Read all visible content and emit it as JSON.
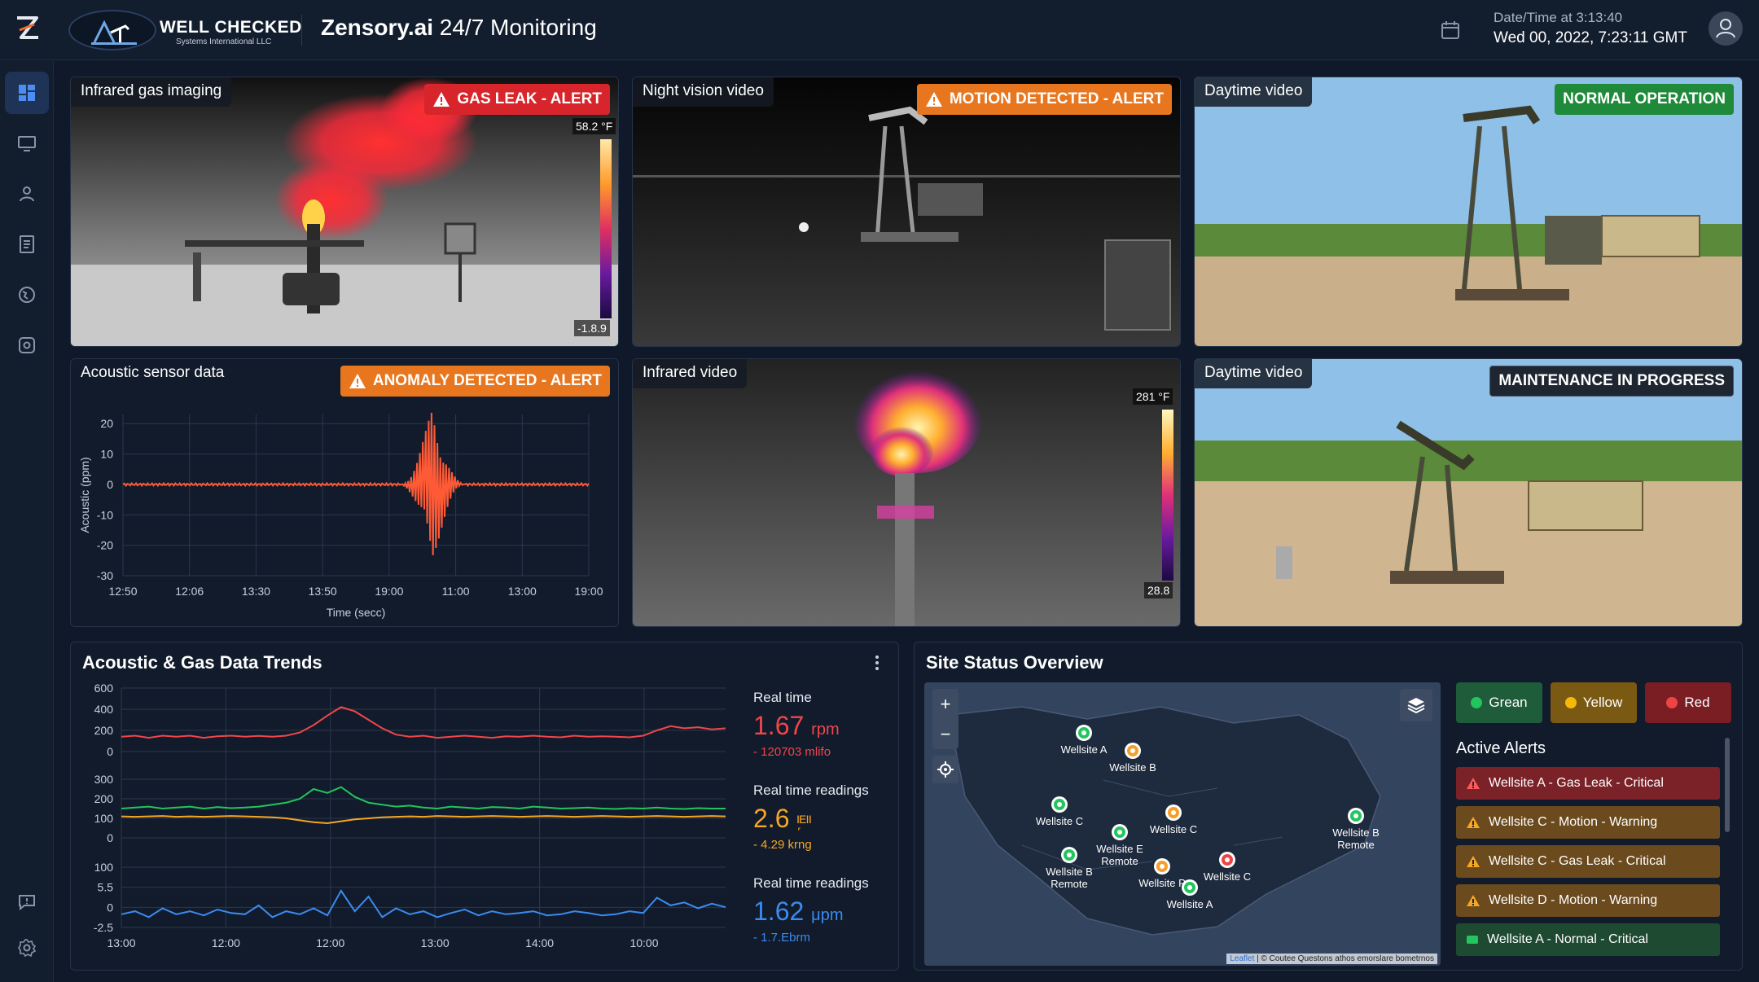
{
  "header": {
    "brand_name": "WELL CHECKED",
    "brand_sub": "Systems International LLC",
    "app_title_bold": "Zensory.ai",
    "app_title_rest": " 24/7 Monitoring",
    "datetime_label": "Date/Time at 3:13:40",
    "datetime_value": "Wed 00, 2022, 7:23:11 GMT"
  },
  "sidebar": {
    "items": [
      {
        "icon": "dashboard-icon",
        "active": true
      },
      {
        "icon": "monitor-icon"
      },
      {
        "icon": "user-icon"
      },
      {
        "icon": "document-icon"
      },
      {
        "icon": "globe-icon"
      },
      {
        "icon": "gear-badge-icon"
      }
    ],
    "bottom": [
      {
        "icon": "chat-icon"
      },
      {
        "icon": "settings-icon"
      }
    ]
  },
  "cameras": [
    {
      "label": "Infrared gas imaging",
      "badge": "GAS LEAK - ALERT",
      "badge_color": "#d8252b",
      "scale_max": "58.2 °F",
      "scale_min": "-1.8.9"
    },
    {
      "label": "Night vision video",
      "badge": "MOTION DETECTED - ALERT",
      "badge_color": "#e8761e"
    },
    {
      "label": "Daytime video",
      "badge": "NORMAL OPERATION",
      "badge_color": "#1e8a3a"
    },
    {
      "label": "Infrared video",
      "scale_max": "281 °F",
      "scale_min": "28.8"
    },
    {
      "label": "Daytime video",
      "badge": "MAINTENANCE IN PROGRESS"
    }
  ],
  "acoustic": {
    "label": "Acoustic sensor data",
    "badge": "ANOMALY DETECTED - ALERT",
    "badge_color": "#e8761e"
  },
  "trends": {
    "title": "Acoustic & Gas Data Trends",
    "readings": [
      {
        "label": "Real time",
        "value": "1.67",
        "unit": "rpm",
        "sub": "- 120703 mlifo",
        "color": "#f0464a"
      },
      {
        "label": "Real time readings",
        "value": "2.6",
        "unit": "ᴵ᷊ᴱᴵᴵ",
        "sub": "- 4.29 krng",
        "color": "#f5a623"
      },
      {
        "label": "Real time readings",
        "value": "1.62",
        "unit": "μpm",
        "sub": "- 1.7.Ebrm",
        "color": "#3b8bf0"
      }
    ]
  },
  "chart_data": [
    {
      "type": "line",
      "title": "",
      "xlabel": "Time (secc)",
      "ylabel": "Acoustic (ppm)",
      "categories": [
        "12:50",
        "12:06",
        "13:30",
        "13:50",
        "19:00",
        "11:00",
        "13:00",
        "19:00"
      ],
      "y_ticks": [
        20,
        10,
        0,
        -10,
        -20,
        -30
      ],
      "ylim": [
        -30,
        23
      ],
      "series": [
        {
          "color": "#ff5a36",
          "baseline": 0,
          "spike_at_category_index": 4.65,
          "spike_range": [
            -30,
            26
          ]
        }
      ],
      "grid": true
    },
    {
      "type": "line",
      "title": "Acoustic & Gas Data Trends",
      "x_ticks": [
        "13:00",
        "12:00",
        "12:00",
        "13:00",
        "14:00",
        "10:00"
      ],
      "panels": [
        {
          "y_ticks": [
            600,
            400,
            200,
            0
          ],
          "ylim": [
            0,
            600
          ],
          "series": [
            {
              "color": "#f0464a",
              "values": [
                140,
                150,
                130,
                150,
                140,
                150,
                130,
                145,
                150,
                140,
                148,
                140,
                150,
                180,
                250,
                340,
                420,
                380,
                300,
                220,
                160,
                140,
                150,
                130,
                140,
                150,
                140,
                130,
                145,
                140,
                150,
                140,
                135,
                150,
                140,
                145,
                140,
                135,
                150,
                200,
                240,
                220,
                230,
                210,
                220
              ]
            }
          ]
        },
        {
          "y_ticks": [
            300,
            200,
            100,
            0
          ],
          "ylim": [
            0,
            300
          ],
          "series": [
            {
              "color": "#22c55e",
              "values": [
                150,
                155,
                160,
                150,
                155,
                160,
                150,
                158,
                152,
                155,
                160,
                170,
                180,
                200,
                250,
                230,
                260,
                210,
                180,
                170,
                160,
                165,
                155,
                150,
                160,
                155,
                150,
                158,
                155,
                150,
                160,
                155,
                150,
                152,
                155,
                150,
                148,
                152,
                150,
                155,
                150,
                148,
                152,
                150,
                150
              ]
            },
            {
              "color": "#f5a623",
              "values": [
                110,
                108,
                110,
                112,
                108,
                110,
                108,
                110,
                112,
                110,
                108,
                105,
                100,
                90,
                80,
                75,
                85,
                95,
                100,
                105,
                108,
                110,
                108,
                112,
                110,
                108,
                110,
                112,
                110,
                108,
                110,
                112,
                110,
                108,
                110,
                112,
                110,
                108,
                110,
                112,
                110,
                108,
                110,
                112,
                110
              ]
            }
          ]
        },
        {
          "y_ticks": [
            "100",
            "5.5",
            "0",
            "-2.5"
          ],
          "ylim": [
            -2.5,
            100
          ],
          "series": [
            {
              "color": "#3b8bf0",
              "values": [
                20,
                25,
                15,
                30,
                20,
                25,
                18,
                28,
                22,
                20,
                35,
                15,
                25,
                20,
                30,
                18,
                60,
                25,
                50,
                15,
                30,
                20,
                25,
                15,
                22,
                28,
                18,
                25,
                20,
                22,
                25,
                18,
                20,
                25,
                22,
                18,
                20,
                25,
                22,
                48,
                35,
                40,
                30,
                38,
                32
              ]
            }
          ]
        }
      ]
    }
  ],
  "site_status": {
    "title": "Site Status Overview",
    "legend": [
      {
        "label": "Grean",
        "color": "#22c55e",
        "bg": "#1e5c3a"
      },
      {
        "label": "Yellow",
        "color": "#f5b90a",
        "bg": "#7a5a12"
      },
      {
        "label": "Red",
        "color": "#ef4444",
        "bg": "#7a1e24"
      }
    ],
    "pins": [
      {
        "label": "Wellsite A",
        "color": "#22c55e"
      },
      {
        "label": "Wellsite B",
        "color": "#f59e2a"
      },
      {
        "label": "Wellsite C",
        "color": "#22c55e"
      },
      {
        "label": "Wellsite C",
        "color": "#f59e2a"
      },
      {
        "label": "Wellsite B\nRemote",
        "color": "#22c55e"
      },
      {
        "label": "Wellsite E\nRemote",
        "color": "#22c55e"
      },
      {
        "label": "Wellsite B\nRemote",
        "color": "#22c55e"
      },
      {
        "label": "Wellsite P",
        "color": "#f59e2a"
      },
      {
        "label": "Wellsite C",
        "color": "#ef4444"
      },
      {
        "label": "Wellsite A",
        "color": "#22c55e"
      }
    ],
    "map_zoom_in": "+",
    "map_zoom_out": "−",
    "attribution_link": "Leaflet",
    "attribution_text": " | © Coutee Questons athos emorslare bometrnos",
    "alerts_title": "Active Alerts",
    "alerts": [
      {
        "text": "Wellsite A - Gas Leak - Critical",
        "bg": "#7a2228",
        "icon": "red"
      },
      {
        "text": "Wellsite C - Motion - Warning",
        "bg": "#6b4a1e",
        "icon": "orange"
      },
      {
        "text": "Wellsite C - Gas Leak - Critical",
        "bg": "#6b4a1e",
        "icon": "orange"
      },
      {
        "text": "Wellsite D - Motion - Warning",
        "bg": "#6b4a1e",
        "icon": "orange"
      },
      {
        "text": "Wellsite A - Normal - Critical",
        "bg": "#1e4a32",
        "icon": "green"
      }
    ]
  }
}
